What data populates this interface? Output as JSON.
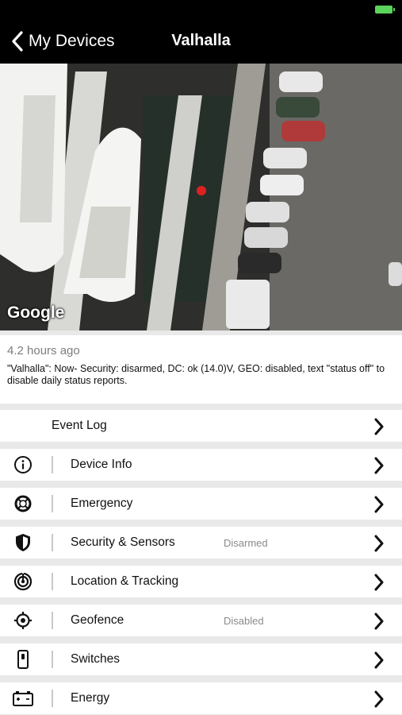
{
  "nav": {
    "back_label": "My Devices",
    "title": "Valhalla"
  },
  "map": {
    "attribution": "Google"
  },
  "status": {
    "time_ago": "4.2 hours ago",
    "message": "\"Valhalla\": Now-  Security: disarmed, DC: ok (14.0)V, GEO: disabled,  text \"status off\" to disable daily status reports."
  },
  "menu": [
    {
      "label": "Event Log",
      "icon": "",
      "status": ""
    },
    {
      "label": "Device Info",
      "icon": "info-icon",
      "status": ""
    },
    {
      "label": "Emergency",
      "icon": "lifebuoy-icon",
      "status": ""
    },
    {
      "label": "Security & Sensors",
      "icon": "shield-icon",
      "status": "Disarmed"
    },
    {
      "label": "Location & Tracking",
      "icon": "location-tracking-icon",
      "status": ""
    },
    {
      "label": "Geofence",
      "icon": "crosshair-icon",
      "status": "Disabled"
    },
    {
      "label": "Switches",
      "icon": "switch-icon",
      "status": ""
    },
    {
      "label": "Energy",
      "icon": "battery-icon",
      "status": ""
    }
  ],
  "colors": {
    "accent": "#ffffff",
    "battery": "#5bd45b",
    "marker": "#e02020"
  }
}
